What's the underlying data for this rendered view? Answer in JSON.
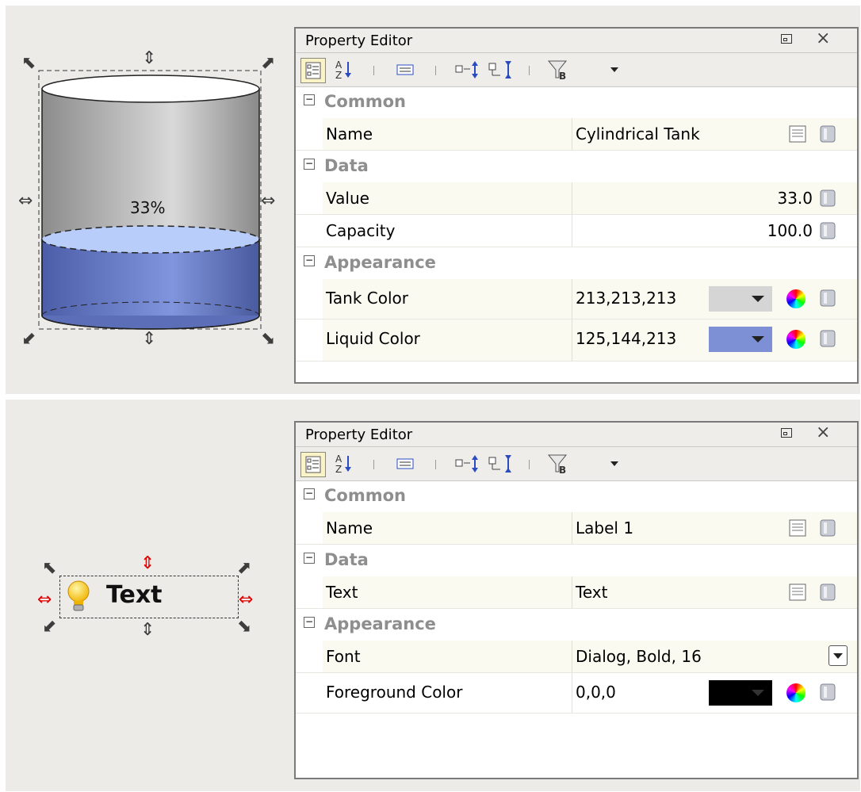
{
  "panels": [
    {
      "canvas": {
        "tank_value_label": "33%",
        "fill_fraction": 0.33
      },
      "editor": {
        "title": "Property Editor",
        "close_glyph": "×",
        "categories": [
          {
            "label": "Common",
            "toggle": "−",
            "rows": [
              {
                "name": "Name",
                "value": "Cylindrical Tank",
                "kind": "text"
              }
            ]
          },
          {
            "label": "Data",
            "toggle": "−",
            "rows": [
              {
                "name": "Value",
                "value": "33.0",
                "kind": "number"
              },
              {
                "name": "Capacity",
                "value": "100.0",
                "kind": "number"
              }
            ]
          },
          {
            "label": "Appearance",
            "toggle": "−",
            "rows": [
              {
                "name": "Tank Color",
                "value": "213,213,213",
                "kind": "color",
                "swatch": "#d5d5d5"
              },
              {
                "name": "Liquid Color",
                "value": "125,144,213",
                "kind": "color",
                "swatch": "#7d90d5"
              }
            ]
          }
        ]
      }
    },
    {
      "canvas": {
        "label_text": "Text"
      },
      "editor": {
        "title": "Property Editor",
        "close_glyph": "×",
        "categories": [
          {
            "label": "Common",
            "toggle": "−",
            "rows": [
              {
                "name": "Name",
                "value": "Label 1",
                "kind": "text"
              }
            ]
          },
          {
            "label": "Data",
            "toggle": "−",
            "rows": [
              {
                "name": "Text",
                "value": "Text",
                "kind": "text"
              }
            ]
          },
          {
            "label": "Appearance",
            "toggle": "−",
            "rows": [
              {
                "name": "Font",
                "value": "Dialog, Bold, 16",
                "kind": "font"
              },
              {
                "name": "Foreground Color",
                "value": "0,0,0",
                "kind": "color",
                "swatch": "#000000"
              }
            ]
          }
        ]
      }
    }
  ],
  "toolbar_icons": [
    "categorized-view-icon",
    "sort-alphabetical-icon",
    "description-icon",
    "expand-all-icon",
    "collapse-all-icon",
    "filter-bindings-icon",
    "dropdown-menu-icon"
  ]
}
